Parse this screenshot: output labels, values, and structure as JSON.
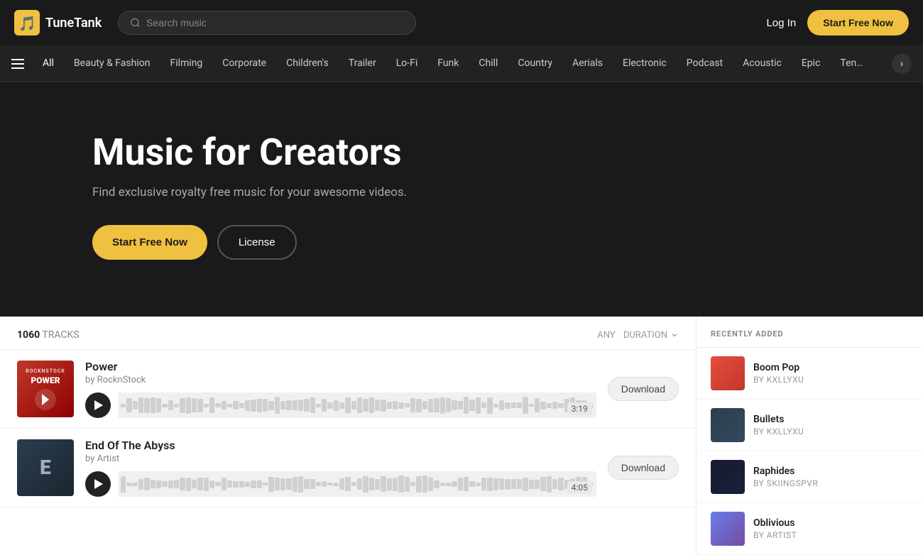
{
  "logo": {
    "name": "TuneTank",
    "icon": "🎵"
  },
  "search": {
    "placeholder": "Search music"
  },
  "nav": {
    "login_label": "Log In",
    "start_free_label": "Start Free Now"
  },
  "categories": [
    {
      "label": "All",
      "active": true
    },
    {
      "label": "Beauty & Fashion"
    },
    {
      "label": "Filming"
    },
    {
      "label": "Corporate"
    },
    {
      "label": "Children's"
    },
    {
      "label": "Trailer"
    },
    {
      "label": "Lo-Fi"
    },
    {
      "label": "Funk"
    },
    {
      "label": "Chill"
    },
    {
      "label": "Country"
    },
    {
      "label": "Aerials"
    },
    {
      "label": "Electronic"
    },
    {
      "label": "Podcast"
    },
    {
      "label": "Acoustic"
    },
    {
      "label": "Epic"
    },
    {
      "label": "Ten…"
    }
  ],
  "hero": {
    "title": "Music for Creators",
    "subtitle": "Find exclusive royalty free music for your awesome videos.",
    "start_free_label": "Start Free Now",
    "license_label": "License"
  },
  "tracks": {
    "count": "1060",
    "count_label": "TRACKS",
    "duration_label": "ANY",
    "duration_filter": "DURATION",
    "items": [
      {
        "title": "Power",
        "artist": "by RocknStock",
        "duration": "3:19",
        "download_label": "Download",
        "thumb_text": "ROCKNSTOCK\nPOWER"
      },
      {
        "title": "End Of The Abyss",
        "artist": "by Artist",
        "duration": "4:05",
        "download_label": "Download",
        "thumb_text": "E"
      }
    ]
  },
  "sidebar": {
    "header": "RECENTLY ADDED",
    "items": [
      {
        "title": "Boom Pop",
        "artist": "by KXLLYXU"
      },
      {
        "title": "Bullets",
        "artist": "by KXLLYXU"
      },
      {
        "title": "Raphides",
        "artist": "by SKIINGSPVR"
      },
      {
        "title": "Oblivious",
        "artist": "by Artist"
      }
    ]
  }
}
